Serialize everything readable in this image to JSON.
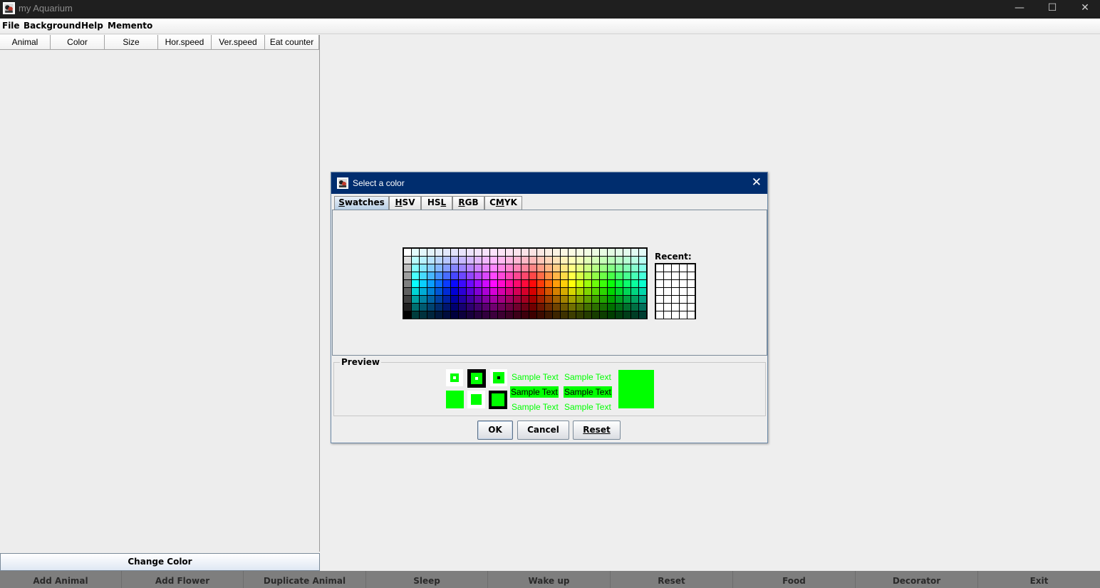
{
  "window": {
    "title": "my Aquarium",
    "minimize": "—",
    "maximize": "☐",
    "close": "✕"
  },
  "menu": [
    "File",
    "Background",
    "Help",
    "Memento"
  ],
  "table": {
    "columns": [
      "Animal",
      "Color",
      "Size",
      "Hor.speed",
      "Ver.speed",
      "Eat counter"
    ]
  },
  "change_color_label": "Change Color",
  "bottom_buttons": [
    "Add Animal",
    "Add Flower",
    "Duplicate Animal",
    "Sleep",
    "Wake up",
    "Reset",
    "Food",
    "Decorator",
    "Exit"
  ],
  "dialog": {
    "title": "Select a color",
    "close": "✕",
    "tabs": [
      {
        "label": "Swatches",
        "mnemonic_index": 0,
        "selected": true
      },
      {
        "label": "HSV",
        "mnemonic_index": 0,
        "selected": false
      },
      {
        "label": "HSL",
        "mnemonic_index": 2,
        "selected": false
      },
      {
        "label": "RGB",
        "mnemonic_index": 0,
        "selected": false
      },
      {
        "label": "CMYK",
        "mnemonic_index": 1,
        "selected": false
      }
    ],
    "recent_label": "Recent:",
    "preview_label": "Preview",
    "sample_text": "Sample Text",
    "selected_color": "#00ff00",
    "buttons": {
      "ok": "OK",
      "cancel": "Cancel",
      "reset": "Reset"
    }
  },
  "colors": {
    "titlebar": "#1f1f1f",
    "dialog_title": "#002d6e",
    "bottom_bar": "#7e7e7e"
  }
}
